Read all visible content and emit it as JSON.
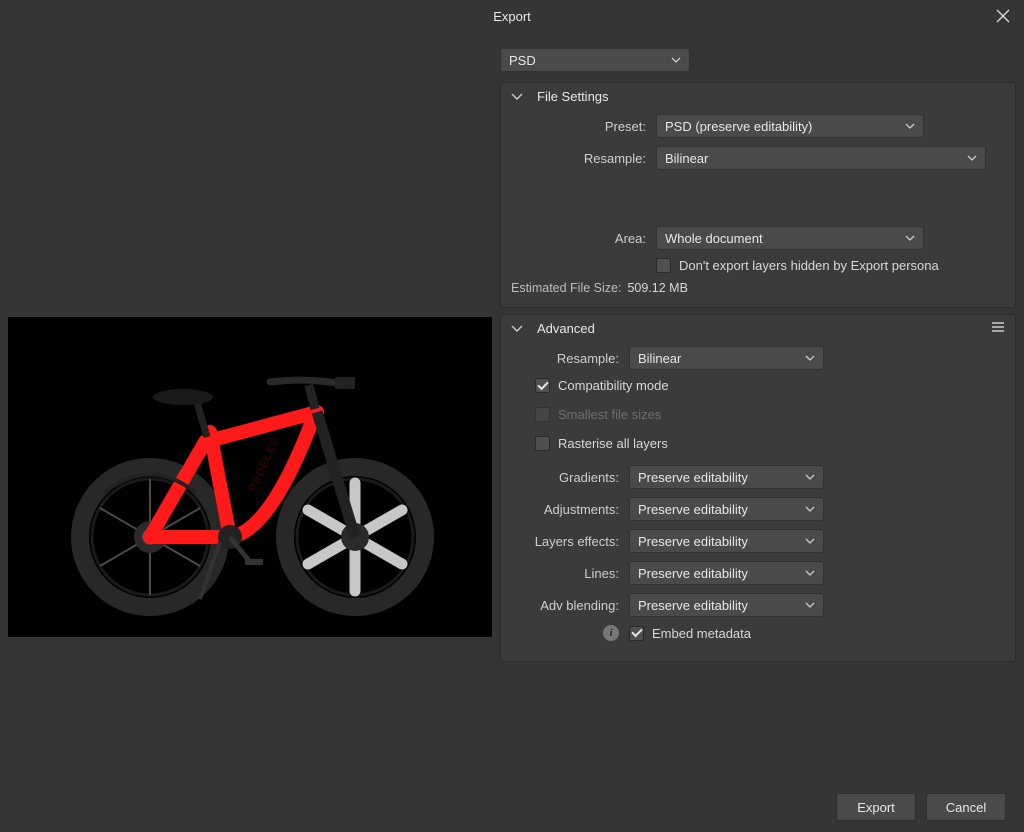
{
  "window": {
    "title": "Export"
  },
  "format": {
    "selected": "PSD"
  },
  "fileSettings": {
    "title": "File Settings",
    "preset": {
      "label": "Preset:",
      "value": "PSD (preserve editability)"
    },
    "resample": {
      "label": "Resample:",
      "value": "Bilinear"
    },
    "area": {
      "label": "Area:",
      "value": "Whole document"
    },
    "hideExportPersona": {
      "label": "Don't export layers hidden by Export persona",
      "checked": false
    },
    "estimated": {
      "label": "Estimated File Size:",
      "value": "509.12 MB"
    }
  },
  "advanced": {
    "title": "Advanced",
    "resample": {
      "label": "Resample:",
      "value": "Bilinear"
    },
    "compatibility": {
      "label": "Compatibility mode",
      "checked": true
    },
    "smallest": {
      "label": "Smallest file sizes",
      "checked": false,
      "disabled": true
    },
    "rasterise": {
      "label": "Rasterise all layers",
      "checked": false
    },
    "gradients": {
      "label": "Gradients:",
      "value": "Preserve editability"
    },
    "adjustments": {
      "label": "Adjustments:",
      "value": "Preserve editability"
    },
    "layerEffects": {
      "label": "Layers effects:",
      "value": "Preserve editability"
    },
    "lines": {
      "label": "Lines:",
      "value": "Preserve editability"
    },
    "advBlending": {
      "label": "Adv blending:",
      "value": "Preserve editability"
    },
    "embed": {
      "label": "Embed metadata",
      "checked": true
    }
  },
  "buttons": {
    "export": "Export",
    "cancel": "Cancel"
  }
}
